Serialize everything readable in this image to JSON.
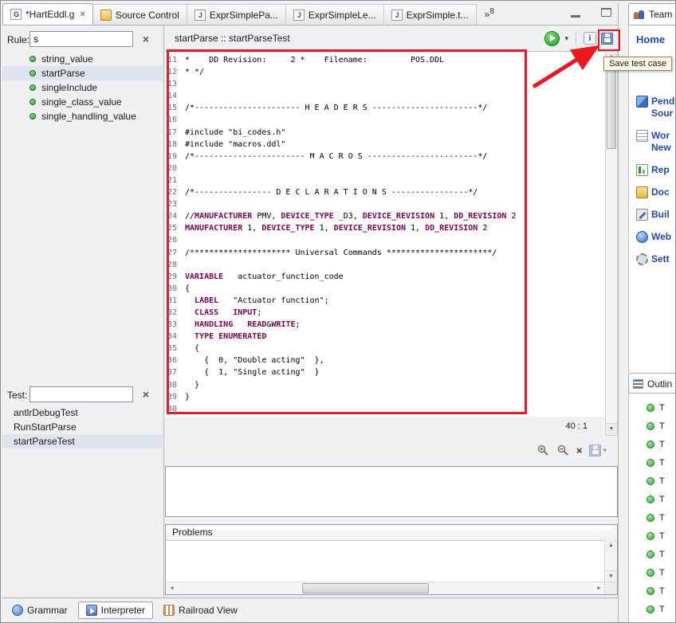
{
  "icons": {
    "close_tab": "×",
    "clear": "×",
    "dropdown_caret": "▾",
    "overflow_chevron": "»",
    "overflow_count": "8",
    "scroll_up": "▲",
    "scroll_down": "▼",
    "scroll_left": "◄",
    "scroll_right": "►",
    "remove": "×",
    "info": "i"
  },
  "tabbar": {
    "tabs": [
      {
        "label": "*HartEddl.g",
        "cls": "active",
        "icon": "ic-grammar",
        "close": "×"
      },
      {
        "label": "Source Control",
        "cls": "",
        "icon": "ic-source",
        "close": ""
      },
      {
        "label": "ExprSimplePa...",
        "cls": "",
        "icon": "ic-file",
        "close": ""
      },
      {
        "label": "ExprSimpleLe...",
        "cls": "",
        "icon": "ic-file",
        "close": ""
      },
      {
        "label": "ExprSimple.t...",
        "cls": "",
        "icon": "ic-file",
        "close": ""
      }
    ]
  },
  "rule_panel": {
    "label": "Rule:",
    "value": "s",
    "items": [
      {
        "label": "string_value",
        "cls": ""
      },
      {
        "label": "startParse",
        "cls": "selected"
      },
      {
        "label": "singleInclude",
        "cls": ""
      },
      {
        "label": "single_class_value",
        "cls": ""
      },
      {
        "label": "single_handling_value",
        "cls": ""
      }
    ]
  },
  "test_panel": {
    "label": "Test:",
    "value": "",
    "items": [
      {
        "label": "antlrDebugTest",
        "cls": ""
      },
      {
        "label": "RunStartParse",
        "cls": ""
      },
      {
        "label": "startParseTest",
        "cls": "selected"
      }
    ]
  },
  "interpreter": {
    "title": "startParse :: startParseTest",
    "caret_position": "40 : 1",
    "save_tooltip": "Save test case"
  },
  "editor": {
    "lines": [
      {
        "n": 11,
        "s": [
          {
            "t": "*    DD Revision:     2 *    Filename:         POS.DDL",
            "c": "p"
          }
        ]
      },
      {
        "n": 12,
        "s": [
          {
            "t": "* */",
            "c": "p"
          }
        ]
      },
      {
        "n": 13,
        "s": []
      },
      {
        "n": 14,
        "s": []
      },
      {
        "n": 15,
        "s": [
          {
            "t": "/*---------------------- H E A D E R S ----------------------*/",
            "c": "p"
          }
        ]
      },
      {
        "n": 16,
        "s": []
      },
      {
        "n": 17,
        "s": [
          {
            "t": "#include \"bi_codes.h\"",
            "c": "p"
          }
        ]
      },
      {
        "n": 18,
        "s": [
          {
            "t": "#include \"macros.ddl\"",
            "c": "p"
          }
        ]
      },
      {
        "n": 19,
        "s": [
          {
            "t": "/*----------------------- M A C R O S -----------------------*/",
            "c": "p"
          }
        ]
      },
      {
        "n": 20,
        "s": []
      },
      {
        "n": 21,
        "s": []
      },
      {
        "n": 22,
        "s": [
          {
            "t": "/*---------------- D E C L A R A T I O N S ----------------*/",
            "c": "p"
          }
        ]
      },
      {
        "n": 23,
        "s": []
      },
      {
        "n": 24,
        "s": [
          {
            "t": "//",
            "c": "p"
          },
          {
            "t": "MANUFACTURER",
            "c": "k"
          },
          {
            "t": " PMV, ",
            "c": "p"
          },
          {
            "t": "DEVICE_TYPE",
            "c": "k"
          },
          {
            "t": " _D3, ",
            "c": "p"
          },
          {
            "t": "DEVICE_REVISION",
            "c": "k"
          },
          {
            "t": " 1, ",
            "c": "p"
          },
          {
            "t": "DD_REVISION",
            "c": "k"
          },
          {
            "t": " 2",
            "c": "p"
          }
        ]
      },
      {
        "n": 25,
        "s": [
          {
            "t": "MANUFACTURER",
            "c": "k"
          },
          {
            "t": " 1, ",
            "c": "p"
          },
          {
            "t": "DEVICE_TYPE",
            "c": "k"
          },
          {
            "t": " 1, ",
            "c": "p"
          },
          {
            "t": "DEVICE_REVISION",
            "c": "k"
          },
          {
            "t": " 1, ",
            "c": "p"
          },
          {
            "t": "DD_REVISION",
            "c": "k"
          },
          {
            "t": " 2",
            "c": "p"
          }
        ]
      },
      {
        "n": 26,
        "s": []
      },
      {
        "n": 27,
        "s": [
          {
            "t": "/********************* Universal Commands **********************/",
            "c": "p"
          }
        ]
      },
      {
        "n": 28,
        "s": []
      },
      {
        "n": 29,
        "s": [
          {
            "t": "VARIABLE",
            "c": "k"
          },
          {
            "t": "   actuator_function_code",
            "c": "p"
          }
        ]
      },
      {
        "n": 30,
        "s": [
          {
            "t": "{",
            "c": "p"
          }
        ]
      },
      {
        "n": 31,
        "s": [
          {
            "t": "  ",
            "c": "p"
          },
          {
            "t": "LABEL",
            "c": "k"
          },
          {
            "t": "   \"Actuator function\";",
            "c": "p"
          }
        ]
      },
      {
        "n": 32,
        "s": [
          {
            "t": "  ",
            "c": "p"
          },
          {
            "t": "CLASS",
            "c": "k"
          },
          {
            "t": "   ",
            "c": "p"
          },
          {
            "t": "INPUT",
            "c": "k"
          },
          {
            "t": ";",
            "c": "p"
          }
        ]
      },
      {
        "n": 33,
        "s": [
          {
            "t": "  ",
            "c": "p"
          },
          {
            "t": "HANDLING",
            "c": "k"
          },
          {
            "t": "   ",
            "c": "p"
          },
          {
            "t": "READ",
            "c": "k"
          },
          {
            "t": "&",
            "c": "p"
          },
          {
            "t": "WRITE",
            "c": "k"
          },
          {
            "t": ";",
            "c": "p"
          }
        ]
      },
      {
        "n": 34,
        "s": [
          {
            "t": "  ",
            "c": "p"
          },
          {
            "t": "TYPE ENUMERATED",
            "c": "k"
          }
        ]
      },
      {
        "n": 35,
        "s": [
          {
            "t": "  {",
            "c": "p"
          }
        ]
      },
      {
        "n": 36,
        "s": [
          {
            "t": "    {  0, \"Double acting\"  },",
            "c": "p"
          }
        ]
      },
      {
        "n": 37,
        "s": [
          {
            "t": "    {  1, \"Single acting\"  }",
            "c": "p"
          }
        ]
      },
      {
        "n": 38,
        "s": [
          {
            "t": "  }",
            "c": "p"
          }
        ]
      },
      {
        "n": 39,
        "s": [
          {
            "t": "}",
            "c": "p"
          }
        ]
      },
      {
        "n": 40,
        "s": []
      }
    ]
  },
  "problems": {
    "title": "Problems"
  },
  "team": {
    "tab": "Team",
    "home": "Home",
    "items": [
      {
        "label": "Pend",
        "sub": "Sour",
        "icon": "tic-pending"
      },
      {
        "label": "Wor",
        "sub": "New",
        "icon": "tic-work"
      },
      {
        "label": "Rep",
        "sub": "",
        "icon": "tic-reports"
      },
      {
        "label": "Doc",
        "sub": "",
        "icon": "tic-docs"
      },
      {
        "label": "Buil",
        "sub": "",
        "icon": "tic-builds"
      },
      {
        "label": "Web",
        "sub": "",
        "icon": "tic-web"
      },
      {
        "label": "Sett",
        "sub": "",
        "icon": "tic-settings"
      }
    ]
  },
  "outline": {
    "tab": "Outlin",
    "items": [
      {
        "label": "T"
      },
      {
        "label": "T"
      },
      {
        "label": "T"
      },
      {
        "label": "T"
      },
      {
        "label": "T"
      },
      {
        "label": "T"
      },
      {
        "label": "T"
      },
      {
        "label": "T"
      },
      {
        "label": "T"
      },
      {
        "label": "T"
      },
      {
        "label": "T"
      },
      {
        "label": "T"
      }
    ]
  },
  "bottom_tabs": [
    {
      "label": "Grammar",
      "cls": "",
      "icon": "bic-grammar"
    },
    {
      "label": "Interpreter",
      "cls": "active",
      "icon": "bic-interp"
    },
    {
      "label": "Railroad View",
      "cls": "",
      "icon": "bic-rail"
    }
  ]
}
